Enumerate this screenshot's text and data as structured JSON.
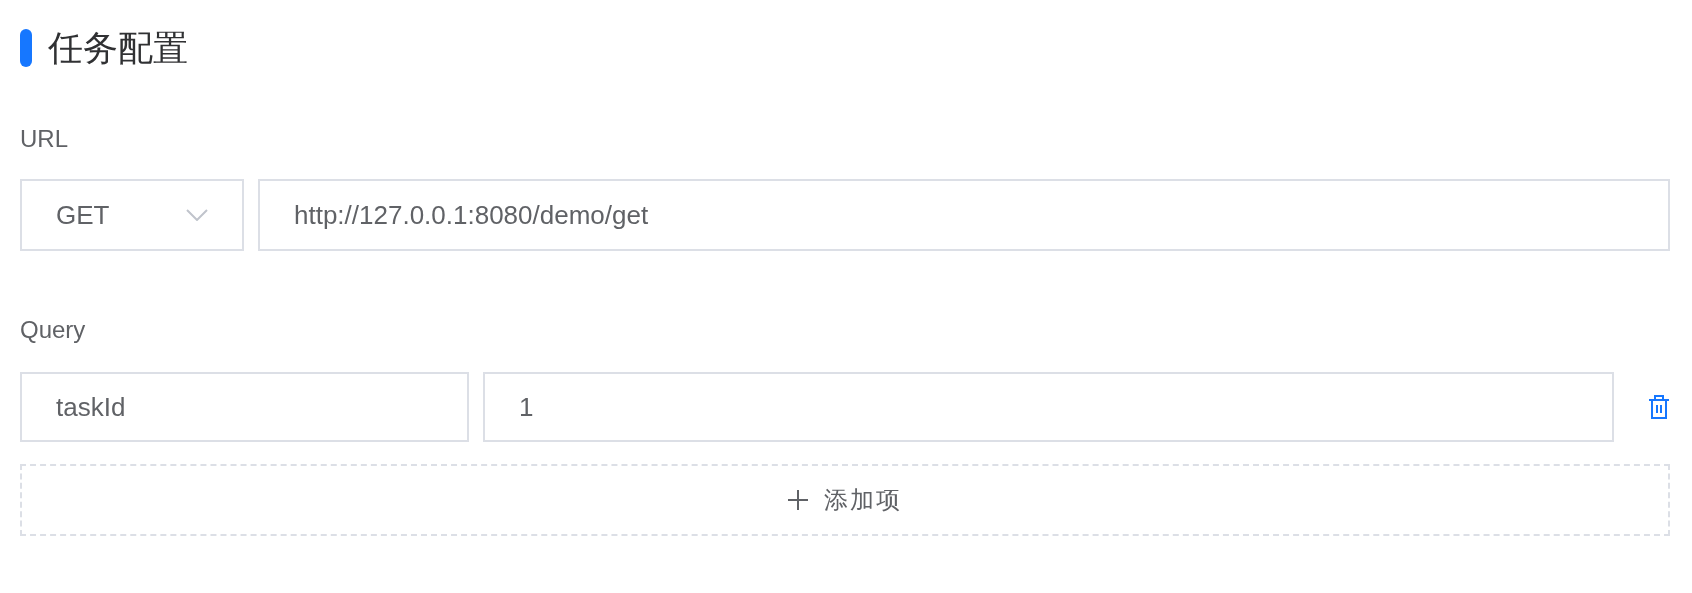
{
  "section": {
    "title": "任务配置"
  },
  "url": {
    "label": "URL",
    "method": "GET",
    "value": "http://127.0.0.1:8080/demo/get"
  },
  "query": {
    "label": "Query",
    "rows": [
      {
        "key": "taskId",
        "value": "1"
      }
    ],
    "add_button": "添加项"
  }
}
